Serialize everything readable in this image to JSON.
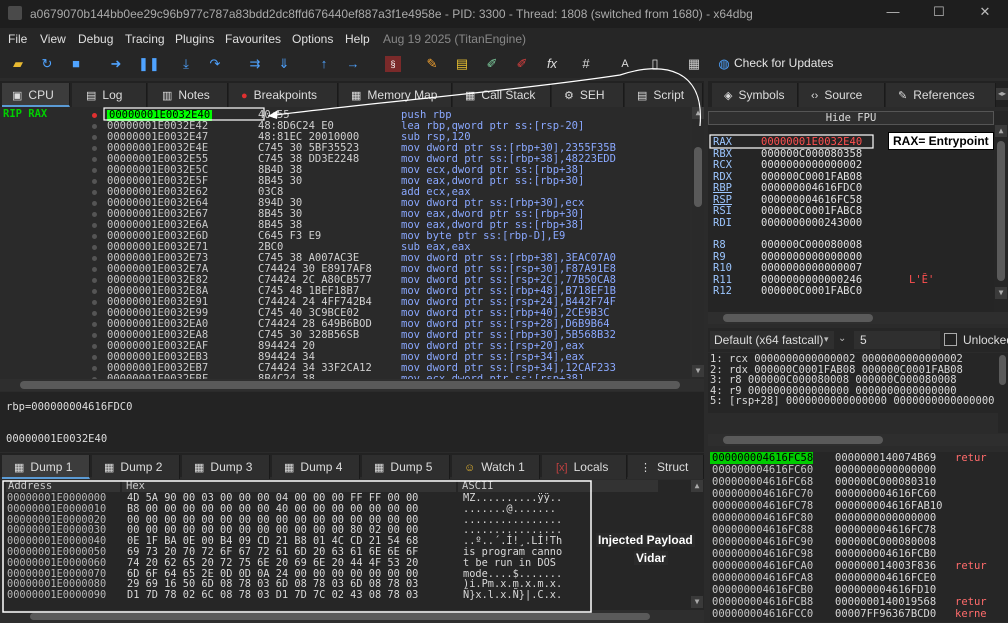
{
  "window": {
    "title": "a0679070b144bb0ee29c96b977c787a83bdd2dc8ffd676440ef887a3f1e4958e - PID: 3300 - Thread: 1808 (switched from 1680) - x64dbg",
    "minimize": "—",
    "maximize": "☐",
    "close": "✕"
  },
  "menu": {
    "items": [
      "File",
      "View",
      "Debug",
      "Tracing",
      "Plugins",
      "Favourites",
      "Options",
      "Help"
    ],
    "date": "Aug 19 2025 (TitanEngine)"
  },
  "toolbar": {
    "check_updates": "Check for Updates"
  },
  "top_tabs": [
    "CPU",
    "Log",
    "Notes",
    "Breakpoints",
    "Memory Map",
    "Call Stack",
    "SEH",
    "Script"
  ],
  "right_tabs": [
    "Symbols",
    "Source",
    "References"
  ],
  "disasm": {
    "rip_label": "RIP RAX",
    "rows": [
      {
        "addr": "00000001E0032E40",
        "bytes": "40:55",
        "instr": "push rbp",
        "current": true
      },
      {
        "addr": "00000001E0032E42",
        "bytes": "48:8D6C24 E0",
        "instr": "lea rbp,qword ptr ss:[rsp-20]"
      },
      {
        "addr": "00000001E0032E47",
        "bytes": "48:81EC 20010000",
        "instr": "sub rsp,120"
      },
      {
        "addr": "00000001E0032E4E",
        "bytes": "C745 30 5BF35523",
        "instr": "mov dword ptr ss:[rbp+30],2355F35B"
      },
      {
        "addr": "00000001E0032E55",
        "bytes": "C745 38 DD3E2248",
        "instr": "mov dword ptr ss:[rbp+38],48223EDD"
      },
      {
        "addr": "00000001E0032E5C",
        "bytes": "8B4D 38",
        "instr": "mov ecx,dword ptr ss:[rbp+38]"
      },
      {
        "addr": "00000001E0032E5F",
        "bytes": "8B45 30",
        "instr": "mov eax,dword ptr ss:[rbp+30]"
      },
      {
        "addr": "00000001E0032E62",
        "bytes": "03C8",
        "instr": "add ecx,eax"
      },
      {
        "addr": "00000001E0032E64",
        "bytes": "894D 30",
        "instr": "mov dword ptr ss:[rbp+30],ecx"
      },
      {
        "addr": "00000001E0032E67",
        "bytes": "8B45 30",
        "instr": "mov eax,dword ptr ss:[rbp+30]"
      },
      {
        "addr": "00000001E0032E6A",
        "bytes": "8B45 38",
        "instr": "mov eax,dword ptr ss:[rbp+38]"
      },
      {
        "addr": "00000001E0032E6D",
        "bytes": "C645 F3 E9",
        "instr": "mov byte ptr ss:[rbp-D],E9"
      },
      {
        "addr": "00000001E0032E71",
        "bytes": "2BC0",
        "instr": "sub eax,eax"
      },
      {
        "addr": "00000001E0032E73",
        "bytes": "C745 38 A007AC3E",
        "instr": "mov dword ptr ss:[rbp+38],3EAC07A0"
      },
      {
        "addr": "00000001E0032E7A",
        "bytes": "C74424 30 E8917AF8",
        "instr": "mov dword ptr ss:[rsp+30],F87A91E8"
      },
      {
        "addr": "00000001E0032E82",
        "bytes": "C74424 2C A80CB577",
        "instr": "mov dword ptr ss:[rsp+2C],77B50CA8"
      },
      {
        "addr": "00000001E0032E8A",
        "bytes": "C745 48 1BEF18B7",
        "instr": "mov dword ptr ss:[rbp+48],B718EF1B"
      },
      {
        "addr": "00000001E0032E91",
        "bytes": "C74424 24 4FF742B4",
        "instr": "mov dword ptr ss:[rsp+24],B442F74F"
      },
      {
        "addr": "00000001E0032E99",
        "bytes": "C745 40 3C9BCE02",
        "instr": "mov dword ptr ss:[rbp+40],2CE9B3C"
      },
      {
        "addr": "00000001E0032EA0",
        "bytes": "C74424 28 649B6BOD",
        "instr": "mov dword ptr ss:[rsp+28],D6B9B64"
      },
      {
        "addr": "00000001E0032EA8",
        "bytes": "C745 30 328B56SB",
        "instr": "mov dword ptr ss:[rbp+30],5B568B32"
      },
      {
        "addr": "00000001E0032EAF",
        "bytes": "894424 20",
        "instr": "mov dword ptr ss:[rsp+20],eax"
      },
      {
        "addr": "00000001E0032EB3",
        "bytes": "894424 34",
        "instr": "mov dword ptr ss:[rsp+34],eax"
      },
      {
        "addr": "00000001E0032EB7",
        "bytes": "C74424 34 33F2CA12",
        "instr": "mov dword ptr ss:[rsp+34],12CAF233"
      },
      {
        "addr": "00000001E0032EBF",
        "bytes": "8B4C24 38",
        "instr": "mov ecx,dword ptr ss:[rsp+38]"
      }
    ]
  },
  "info": {
    "line1": "rbp=000000004616FDC0",
    "line2": "00000001E0032E40"
  },
  "dump_tabs": [
    "Dump 1",
    "Dump 2",
    "Dump 3",
    "Dump 4",
    "Dump 5",
    "Watch 1",
    "Locals",
    "Struct"
  ],
  "dump": {
    "col_address": "Address",
    "col_hex": "Hex",
    "col_ascii": "ASCII",
    "rows": [
      {
        "a": "00000001E0000000",
        "h": "4D 5A 90 00 03 00 00 00 04 00 00 00 FF FF 00 00",
        "s": "MZ..........ÿÿ.."
      },
      {
        "a": "00000001E0000010",
        "h": "B8 00 00 00 00 00 00 00 40 00 00 00 00 00 00 00",
        "s": ".......@......."
      },
      {
        "a": "00000001E0000020",
        "h": "00 00 00 00 00 00 00 00 00 00 00 00 00 00 00 00",
        "s": "................"
      },
      {
        "a": "00000001E0000030",
        "h": "00 00 00 00 00 00 00 00 00 00 00 00 80 02 00 00",
        "s": "................"
      },
      {
        "a": "00000001E0000040",
        "h": "0E 1F BA 0E 00 B4 09 CD 21 B8 01 4C CD 21 54 68",
        "s": "..º..´.Í!¸.LÍ!Th"
      },
      {
        "a": "00000001E0000050",
        "h": "69 73 20 70 72 6F 67 72 61 6D 20 63 61 6E 6E 6F",
        "s": "is program canno"
      },
      {
        "a": "00000001E0000060",
        "h": "74 20 62 65 20 72 75 6E 20 69 6E 20 44 4F 53 20",
        "s": "t be run in DOS "
      },
      {
        "a": "00000001E0000070",
        "h": "6D 6F 64 65 2E 0D 0D 0A 24 00 00 00 00 00 00 00",
        "s": "mode....$......."
      },
      {
        "a": "00000001E0000080",
        "h": "29 69 16 50 6D 08 78 03 6D 08 78 03 6D 08 78 03",
        "s": ")i.Pm.x.m.x.m.x."
      },
      {
        "a": "00000001E0000090",
        "h": "D1 7D 78 02 6C 08 78 03 D1 7D 7C 02 43 08 78 03",
        "s": "Ñ}x.l.x.Ñ}|.C.x."
      }
    ]
  },
  "fpu": {
    "label": "Hide FPU"
  },
  "registers": [
    {
      "name": "RAX",
      "value": "00000001E0032E40",
      "mod": true
    },
    {
      "name": "RBX",
      "value": "000000C000080358"
    },
    {
      "name": "RCX",
      "value": "0000000000000002"
    },
    {
      "name": "RDX",
      "value": "000000C0001FAB08"
    },
    {
      "name": "RBP",
      "value": "000000004616FDC0"
    },
    {
      "name": "RSP",
      "value": "000000004616FC58"
    },
    {
      "name": "RSI",
      "value": "000000C0001FABC8"
    },
    {
      "name": "RDI",
      "value": "0000000000243000"
    },
    {
      "name": "R8",
      "value": "000000C000080008",
      "gap": true
    },
    {
      "name": "R9",
      "value": "0000000000000000"
    },
    {
      "name": "R10",
      "value": "0000000000000007"
    },
    {
      "name": "R11",
      "value": "0000000000000246",
      "comment": "L'Ȇ'"
    },
    {
      "name": "R12",
      "value": "000000C0001FABC0"
    }
  ],
  "callconv": {
    "label": "Default (x64 fastcall)",
    "count": "5",
    "unlocked": "Unlocked"
  },
  "args": [
    "1: rcx 0000000000000002 0000000000000002",
    "2: rdx 000000C0001FAB08 000000C0001FAB08",
    "3: r8 000000C000080008 000000C000080008",
    "4: r9 0000000000000000 0000000000000000",
    "5: [rsp+28] 0000000000000000 0000000000000000"
  ],
  "stack": [
    {
      "a": "000000004616FC58",
      "v": "0000000140074B69",
      "c": "retur",
      "current": true
    },
    {
      "a": "000000004616FC60",
      "v": "0000000000000000",
      "c": ""
    },
    {
      "a": "000000004616FC68",
      "v": "000000C000080310",
      "c": ""
    },
    {
      "a": "000000004616FC70",
      "v": "000000004616FC60",
      "c": ""
    },
    {
      "a": "000000004616FC78",
      "v": "000000004616FAB10",
      "c": ""
    },
    {
      "a": "000000004616FC80",
      "v": "0000000000000000",
      "c": ""
    },
    {
      "a": "000000004616FC88",
      "v": "000000004616FC78",
      "c": ""
    },
    {
      "a": "000000004616FC90",
      "v": "000000C000080008",
      "c": ""
    },
    {
      "a": "000000004616FC98",
      "v": "000000004616FCB0",
      "c": ""
    },
    {
      "a": "000000004616FCA0",
      "v": "000000014003F836",
      "c": "retur"
    },
    {
      "a": "000000004616FCA8",
      "v": "000000004616FCE0",
      "c": ""
    },
    {
      "a": "000000004616FCB0",
      "v": "000000004616FD10",
      "c": ""
    },
    {
      "a": "000000004616FCB8",
      "v": "0000000140019568",
      "c": "retur"
    },
    {
      "a": "000000004616FCC0",
      "v": "00007FF96367BCD0",
      "c": "kerne"
    }
  ],
  "annotations": {
    "rax": "RAX= Entrypoint",
    "payload_line1": "Injected Payload",
    "payload_line2": "Vidar"
  },
  "colors": {
    "accent": "#5b9bd5",
    "current_row": "#00ff00",
    "stack_highlight": "#00cc00",
    "comment": "#ff6b6b"
  }
}
